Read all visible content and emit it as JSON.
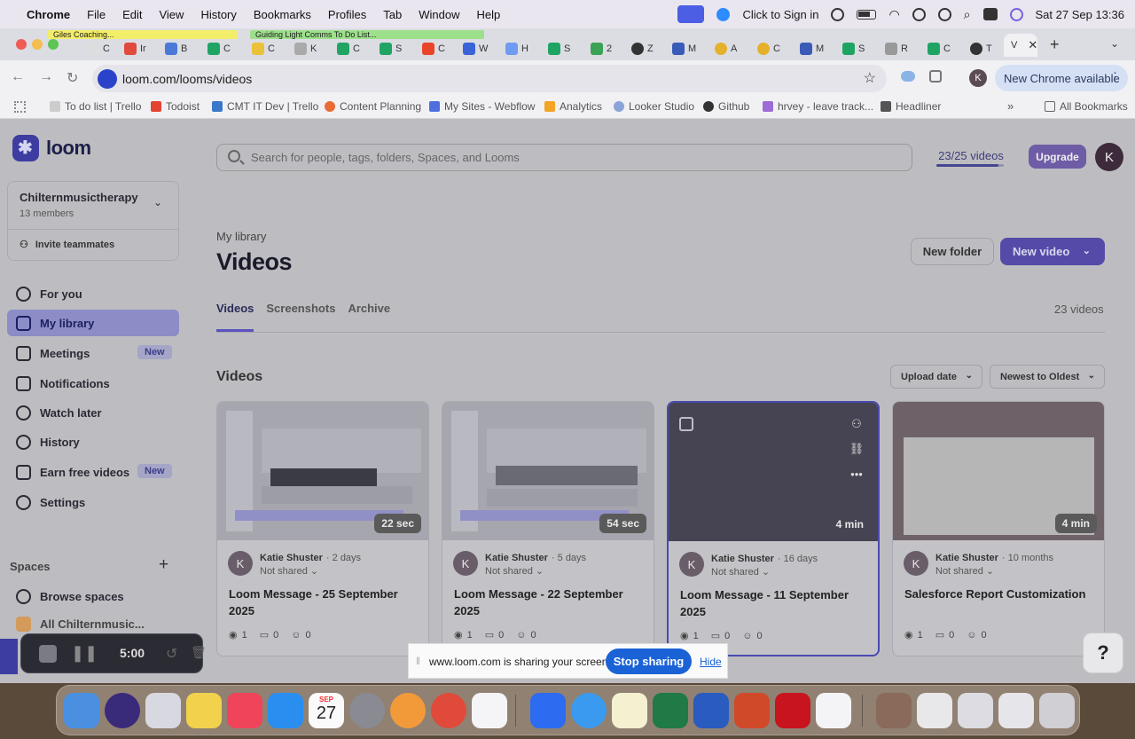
{
  "menubar": {
    "app_name": "Chrome",
    "items": [
      "File",
      "Edit",
      "View",
      "History",
      "Bookmarks",
      "Profiles",
      "Tab",
      "Window",
      "Help"
    ],
    "click_to_sign_in": "Click to Sign in",
    "datetime": "Sat 27 Sep  13:36"
  },
  "tabs": {
    "group_1": "Giles Coaching...",
    "group_2": "Guiding Light Comms To Do List...",
    "items": [
      "C",
      "Ir",
      "B",
      "C",
      "C",
      "K",
      "C",
      "S",
      "C",
      "W",
      "H",
      "S",
      "2",
      "Z",
      "M",
      "A",
      "C",
      "M",
      "S",
      "R",
      "C",
      "T",
      "V"
    ]
  },
  "addressbar": {
    "url": "loom.com/looms/videos",
    "new_chrome": "New Chrome available",
    "profile_initial": "K"
  },
  "bookmarks": [
    "To do list | Trello",
    "Todoist",
    "CMT IT Dev | Trello",
    "Content Planning",
    "My Sites - Webflow",
    "Analytics",
    "Looker Studio",
    "Github",
    "hrvey - leave track...",
    "Headliner"
  ],
  "all_bookmarks": "All Bookmarks",
  "sidebar": {
    "logo": "loom",
    "workspace_name": "Chilternmusictherapy",
    "workspace_members": "13 members",
    "invite": "Invite teammates",
    "items": [
      {
        "label": "For you"
      },
      {
        "label": "My library"
      },
      {
        "label": "Meetings",
        "badge": "New"
      },
      {
        "label": "Notifications"
      },
      {
        "label": "Watch later"
      },
      {
        "label": "History"
      },
      {
        "label": "Earn free videos",
        "badge": "New"
      },
      {
        "label": "Settings"
      }
    ],
    "spaces_label": "Spaces",
    "browse_spaces": "Browse spaces",
    "all_space": "All Chilternmusic..."
  },
  "header": {
    "search_placeholder": "Search for people, tags, folders, Spaces, and Looms",
    "video_quota": "23/25 videos",
    "video_quota_used": 23,
    "video_quota_total": 25,
    "upgrade": "Upgrade",
    "avatar_initial": "K"
  },
  "main": {
    "breadcrumb": "My library",
    "title": "Videos",
    "new_folder": "New folder",
    "new_video": "New video",
    "tabs": [
      "Videos",
      "Screenshots",
      "Archive"
    ],
    "total": "23 videos",
    "section": "Videos",
    "sort_field": "Upload date",
    "sort_order": "Newest to Oldest"
  },
  "cards": [
    {
      "duration": "22 sec",
      "author": "Katie Shuster",
      "ago": "· 2 days",
      "shared": "Not shared",
      "title": "Loom Message - 25 September 2025",
      "views": "1",
      "comments": "0",
      "reactions": "0"
    },
    {
      "duration": "54 sec",
      "author": "Katie Shuster",
      "ago": "· 5 days",
      "shared": "Not shared",
      "title": "Loom Message - 22 September 2025",
      "views": "1",
      "comments": "0",
      "reactions": "0"
    },
    {
      "duration": "4 min",
      "author": "Katie Shuster",
      "ago": "· 16 days",
      "shared": "Not shared",
      "title": "Loom Message - 11 September 2025",
      "views": "1",
      "comments": "0",
      "reactions": "0"
    },
    {
      "duration": "4 min",
      "author": "Katie Shuster",
      "ago": "· 10 months",
      "shared": "Not shared",
      "title": "Salesforce Report Customization",
      "views": "1",
      "comments": "0",
      "reactions": "0"
    }
  ],
  "recorder": {
    "time": "5:00"
  },
  "share_banner": {
    "message": "www.loom.com is sharing your screen.",
    "stop": "Stop sharing",
    "hide": "Hide"
  },
  "help": "?",
  "calendar": {
    "month": "SEP",
    "day": "27"
  },
  "colors": {
    "accent": "#554aa7",
    "stop_sharing": "#1a62d6"
  }
}
